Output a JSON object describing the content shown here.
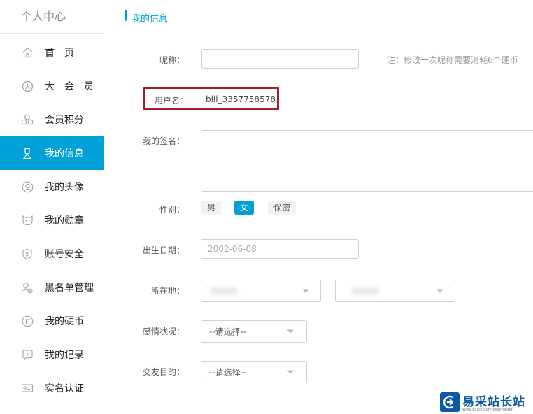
{
  "sidebar": {
    "title": "个人中心",
    "items": [
      {
        "label": "首　页",
        "icon": "home-icon"
      },
      {
        "label": "大会员",
        "icon": "vip-icon"
      },
      {
        "label": "会员积分",
        "icon": "points-icon"
      },
      {
        "label": "我的信息",
        "icon": "user-info-icon",
        "active": true
      },
      {
        "label": "我的头像",
        "icon": "avatar-icon"
      },
      {
        "label": "我的勋章",
        "icon": "medal-icon"
      },
      {
        "label": "账号安全",
        "icon": "shield-icon"
      },
      {
        "label": "黑名单管理",
        "icon": "blacklist-icon"
      },
      {
        "label": "我的硬币",
        "icon": "coin-icon"
      },
      {
        "label": "我的记录",
        "icon": "record-icon"
      },
      {
        "label": "实名认证",
        "icon": "id-card-icon"
      }
    ]
  },
  "header": {
    "title": "我的信息"
  },
  "form": {
    "nickname": {
      "label": "昵称：",
      "value": "",
      "hint": "注：修改一次昵称需要消耗6个硬币"
    },
    "username": {
      "label": "用户名：",
      "value": "bili_3357758578"
    },
    "signature": {
      "label": "我的签名：",
      "value": ""
    },
    "gender": {
      "label": "性别：",
      "options": [
        "男",
        "女",
        "保密"
      ],
      "selected": "女"
    },
    "birthday": {
      "label": "出生日期：",
      "value": "2002-06-08"
    },
    "location": {
      "label": "所在地："
    },
    "relationship": {
      "label": "感情状况：",
      "value": "--请选择--"
    },
    "purpose": {
      "label": "交友目的：",
      "value": "--请选择--"
    }
  },
  "watermark": {
    "text": "易采站长站",
    "sub": "Www.Easck.Com Webmaster"
  },
  "colors": {
    "accent": "#00a1d6",
    "highlight_border": "#a51d22",
    "watermark": "#0b5aa6"
  }
}
